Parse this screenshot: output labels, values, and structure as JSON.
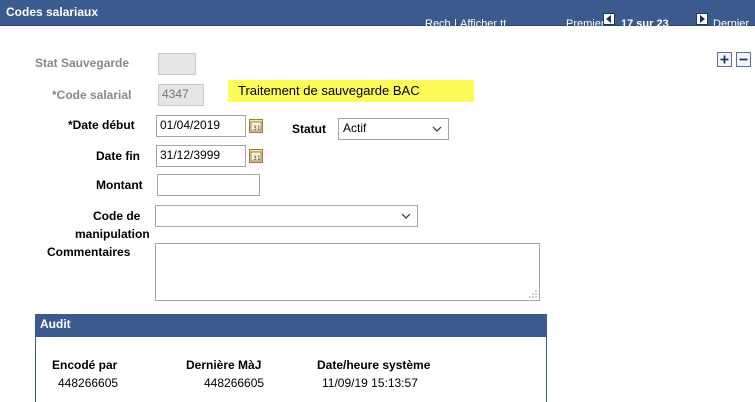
{
  "header": {
    "title": "Codes salariaux",
    "search_link": "Rech.",
    "separator": "|",
    "show_all_link": "Afficher tt",
    "first_link": "Premier",
    "count_text": "17 sur 23",
    "last_link": "Dernier"
  },
  "form": {
    "stat_label": "Stat Sauvegarde",
    "stat_value": "",
    "code_label": "*Code salarial",
    "code_value": "4347",
    "code_description": "Traitement de sauvegarde BAC",
    "start_label": "*Date début",
    "start_value": "01/04/2019",
    "status_label": "Statut",
    "status_value": "Actif",
    "end_label": "Date fin",
    "end_value": "31/12/3999",
    "amount_label": "Montant",
    "amount_value": "",
    "manip_label_1": "Code de",
    "manip_label_2": "manipulation",
    "manip_value": "",
    "comments_label": "Commentaires",
    "comments_value": ""
  },
  "audit": {
    "title": "Audit",
    "col1_header": "Encodé par",
    "col1_value": "448266605",
    "col2_header": "Dernière MàJ",
    "col2_value": "448266605",
    "col3_header": "Date/heure système",
    "col3_value": "11/09/19 15:13:57"
  },
  "colors": {
    "header_bg": "#3b5b8f",
    "highlight": "#fbfb5a"
  },
  "icons": [
    "previous-arrow-icon",
    "next-arrow-icon",
    "plus-icon",
    "minus-icon",
    "calendar-icon",
    "chevron-down-icon"
  ]
}
